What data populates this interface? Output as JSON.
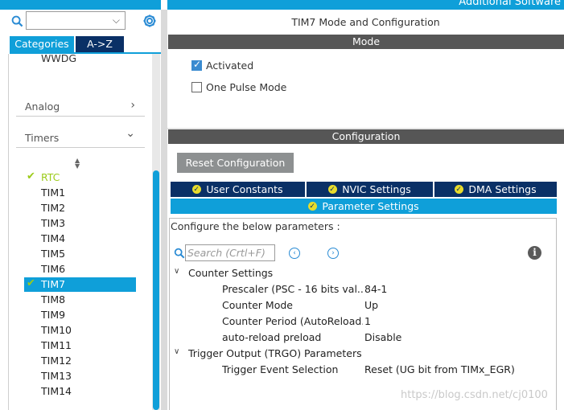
{
  "header": {
    "right_label": "Additional Software"
  },
  "left": {
    "search_placeholder": "",
    "tabs": {
      "categories": "Categories",
      "az": "A->Z"
    },
    "partial_item": "WWDG",
    "categories": [
      {
        "label": "Analog",
        "chevron": "›"
      },
      {
        "label": "Timers",
        "chevron": "⌄"
      }
    ],
    "timers": [
      {
        "label": "RTC",
        "checked": true
      },
      {
        "label": "TIM1"
      },
      {
        "label": "TIM2"
      },
      {
        "label": "TIM3"
      },
      {
        "label": "TIM4"
      },
      {
        "label": "TIM5"
      },
      {
        "label": "TIM6"
      },
      {
        "label": "TIM7",
        "checked": true,
        "selected": true
      },
      {
        "label": "TIM8"
      },
      {
        "label": "TIM9"
      },
      {
        "label": "TIM10"
      },
      {
        "label": "TIM11"
      },
      {
        "label": "TIM12"
      },
      {
        "label": "TIM13"
      },
      {
        "label": "TIM14"
      }
    ]
  },
  "main": {
    "title": "TIM7 Mode and Configuration",
    "mode": {
      "header": "Mode",
      "activated": {
        "label": "Activated",
        "checked": true
      },
      "one_pulse": {
        "label": "One Pulse Mode",
        "checked": false
      }
    },
    "configuration": {
      "header": "Configuration",
      "reset_button": "Reset Configuration",
      "tabs": [
        "User Constants",
        "NVIC Settings",
        "DMA Settings",
        "Parameter Settings"
      ],
      "active_tab": "Parameter Settings",
      "params_header": "Configure the below parameters :",
      "search_placeholder": "Search (Crtl+F)",
      "groups": [
        {
          "name": "Counter Settings",
          "params": [
            {
              "key": "Prescaler (PSC - 16 bits val...",
              "value": "84-1"
            },
            {
              "key": "Counter Mode",
              "value": "Up"
            },
            {
              "key": "Counter Period (AutoReload...",
              "value": "1"
            },
            {
              "key": "auto-reload preload",
              "value": "Disable"
            }
          ]
        },
        {
          "name": "Trigger Output (TRGO) Parameters",
          "params": [
            {
              "key": "Trigger Event Selection",
              "value": "Reset (UG bit from TIMx_EGR)"
            }
          ]
        }
      ]
    }
  },
  "watermark": "https://blog.csdn.net/cj0100",
  "colors": {
    "accent": "#0f9fd9",
    "navy": "#0a3066",
    "check_green": "#9ccb19",
    "bar_gray": "#565656"
  }
}
